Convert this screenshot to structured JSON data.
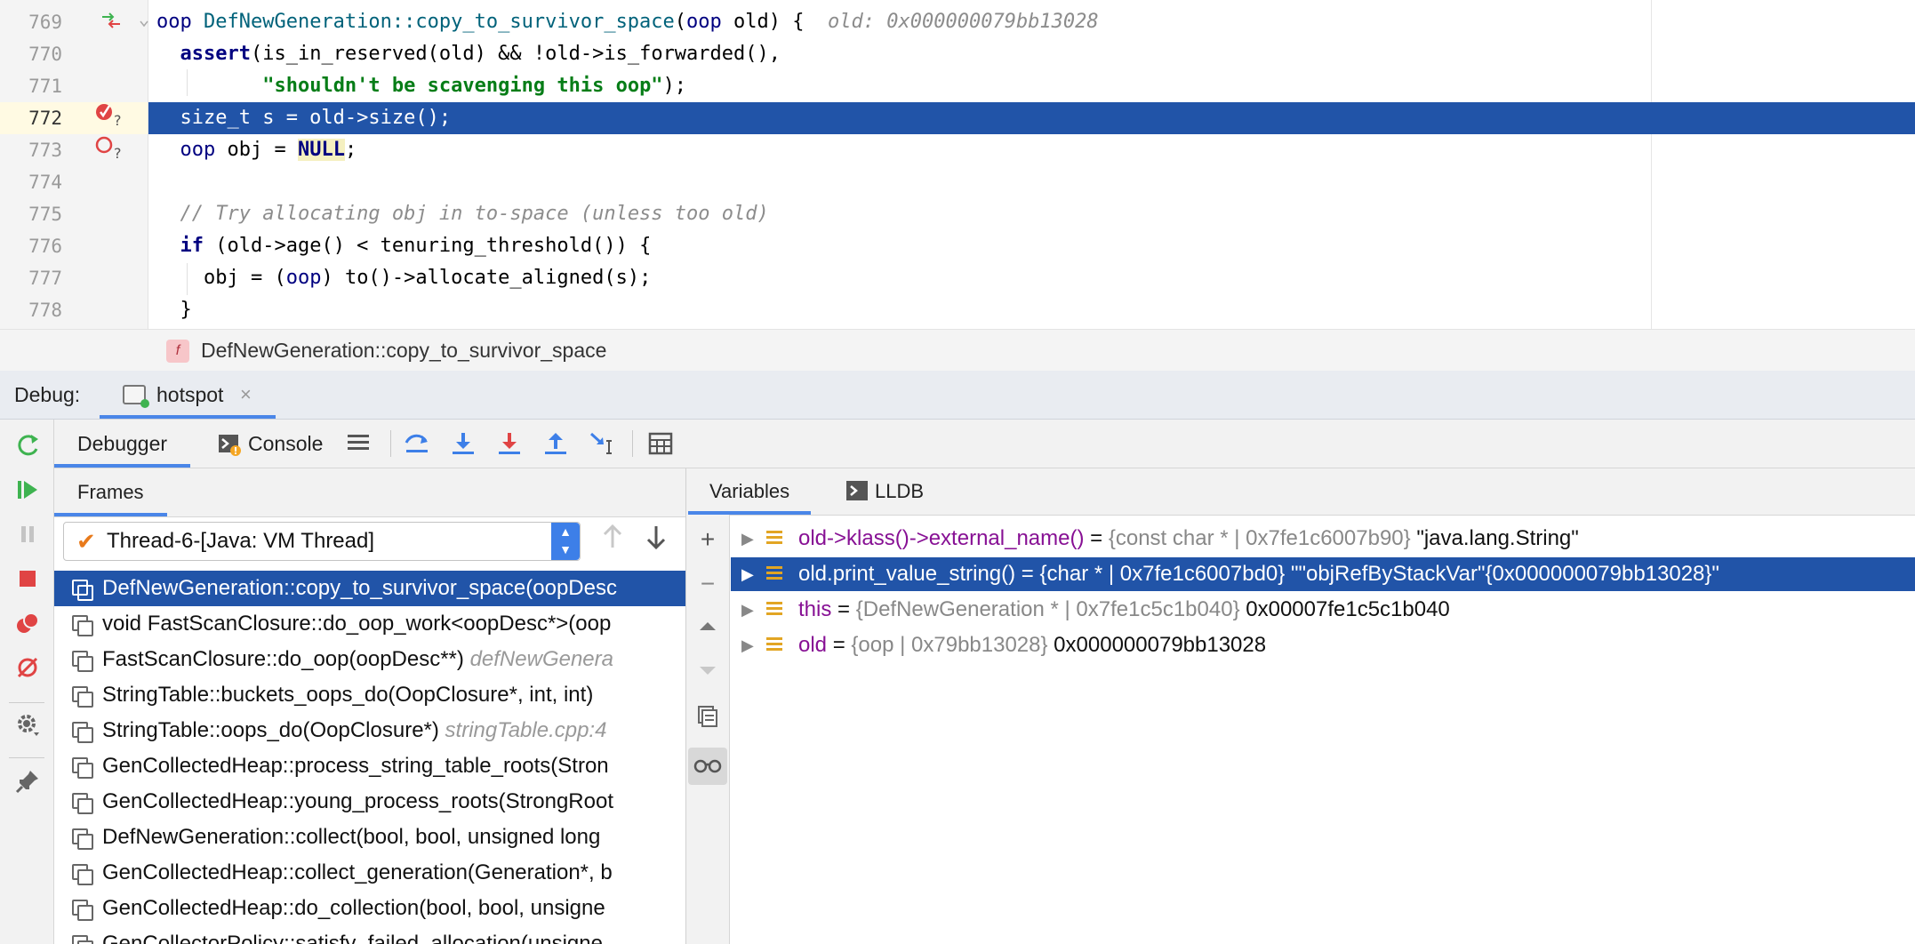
{
  "editor": {
    "lines": [
      {
        "num": "769",
        "tokens": [
          [
            "type",
            "oop "
          ],
          [
            "fn",
            "DefNewGeneration::copy_to_survivor_space"
          ],
          [
            "",
            "("
          ],
          [
            "type",
            "oop"
          ],
          [
            "",
            " old) {  "
          ],
          [
            "inl",
            "old: 0x000000079bb13028"
          ]
        ]
      },
      {
        "num": "770",
        "tokens": [
          [
            "",
            "  "
          ],
          [
            "kw",
            "assert"
          ],
          [
            "",
            "(is_in_reserved(old) && !old->is_forwarded(),"
          ]
        ]
      },
      {
        "num": "771",
        "tokens": [
          [
            "",
            "         "
          ],
          [
            "str",
            "\"shouldn't be scavenging this oop\""
          ],
          [
            "",
            ");"
          ]
        ]
      },
      {
        "num": "772",
        "tokens": [
          [
            "",
            "  size_t s = old->size();"
          ]
        ]
      },
      {
        "num": "773",
        "tokens": [
          [
            "",
            "  "
          ],
          [
            "type",
            "oop"
          ],
          [
            "",
            " obj = "
          ],
          [
            "null",
            "NULL"
          ],
          [
            "",
            ";"
          ]
        ]
      },
      {
        "num": "774",
        "tokens": [
          [
            "",
            ""
          ]
        ]
      },
      {
        "num": "775",
        "tokens": [
          [
            "",
            "  "
          ],
          [
            "cmt",
            "// Try allocating obj in to-space (unless too old)"
          ]
        ]
      },
      {
        "num": "776",
        "tokens": [
          [
            "",
            "  "
          ],
          [
            "kw",
            "if"
          ],
          [
            "",
            " (old->age() < tenuring_threshold()) {"
          ]
        ]
      },
      {
        "num": "777",
        "tokens": [
          [
            "",
            "    obj = ("
          ],
          [
            "type",
            "oop"
          ],
          [
            "",
            ") to()->allocate_aligned(s);"
          ]
        ]
      },
      {
        "num": "778",
        "tokens": [
          [
            "",
            "  }"
          ]
        ]
      }
    ],
    "breadcrumb_badge": "f",
    "breadcrumb": "DefNewGeneration::copy_to_survivor_space"
  },
  "debug": {
    "label": "Debug:",
    "session_tab": "hotspot",
    "close_glyph": "×",
    "tabs": {
      "debugger": "Debugger",
      "console": "Console"
    },
    "frames_title": "Frames",
    "thread": "Thread-6-[Java: VM Thread]",
    "frames": [
      {
        "sig": "DefNewGeneration::copy_to_survivor_space(oopDesc",
        "loc": ""
      },
      {
        "sig": "void FastScanClosure::do_oop_work<oopDesc*>(oop",
        "loc": ""
      },
      {
        "sig": "FastScanClosure::do_oop(oopDesc**) ",
        "loc": "defNewGenera"
      },
      {
        "sig": "StringTable::buckets_oops_do(OopClosure*, int, int)",
        "loc": ""
      },
      {
        "sig": "StringTable::oops_do(OopClosure*) ",
        "loc": "stringTable.cpp:4"
      },
      {
        "sig": "GenCollectedHeap::process_string_table_roots(Stron",
        "loc": ""
      },
      {
        "sig": "GenCollectedHeap::young_process_roots(StrongRoot",
        "loc": ""
      },
      {
        "sig": "DefNewGeneration::collect(bool, bool, unsigned long",
        "loc": ""
      },
      {
        "sig": "GenCollectedHeap::collect_generation(Generation*, b",
        "loc": ""
      },
      {
        "sig": "GenCollectedHeap::do_collection(bool, bool, unsigne",
        "loc": ""
      },
      {
        "sig": "GenCollectorPolicy::satisfy_failed_allocation(unsigne",
        "loc": ""
      }
    ],
    "vars_tabs": {
      "variables": "Variables",
      "lldb": "LLDB"
    },
    "variables": [
      {
        "name": "old->klass()->external_name()",
        "eq": " = ",
        "type": "{const char * | 0x7fe1c6007b90}",
        "value": " \"java.lang.String\""
      },
      {
        "name": "old.print_value_string()",
        "eq": " = ",
        "type": "{char * | 0x7fe1c6007bd0}",
        "value": " \"\"objRefByStackVar\"{0x000000079bb13028}\""
      },
      {
        "name": "this",
        "eq": " = ",
        "type": "{DefNewGeneration * | 0x7fe1c5c1b040}",
        "value": " 0x00007fe1c5c1b040"
      },
      {
        "name": "old",
        "eq": " = ",
        "type": "{oop | 0x79bb13028}",
        "value": " 0x000000079bb13028"
      }
    ]
  },
  "colors": {
    "selection": "#2154a8",
    "accent": "#4a86e8",
    "current_line_gutter": "#fffae3"
  }
}
